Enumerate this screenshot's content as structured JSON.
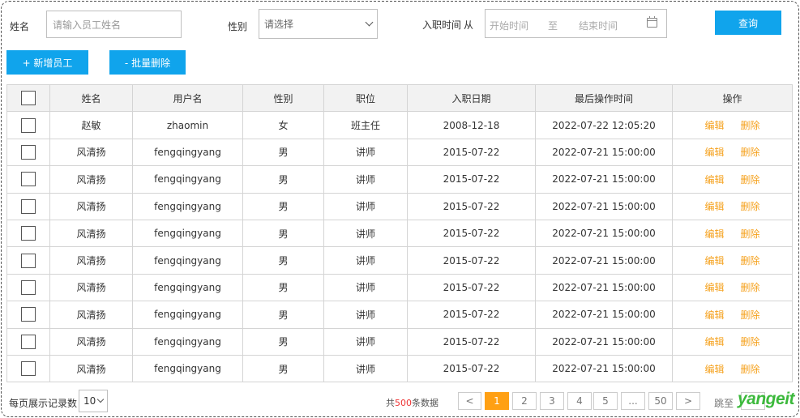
{
  "filters": {
    "name_label": "姓名",
    "name_placeholder": "请输入员工姓名",
    "gender_label": "性别",
    "gender_placeholder": "请选择",
    "date_label": "入职时间",
    "date_from": "从",
    "date_start_placeholder": "开始时间",
    "date_to": "至",
    "date_end_placeholder": "结束时间",
    "query_button": "查询"
  },
  "toolbar": {
    "add_button": "+ 新增员工",
    "batch_delete_button": "- 批量删除"
  },
  "table": {
    "headers": [
      "姓名",
      "用户名",
      "性别",
      "职位",
      "入职日期",
      "最后操作时间",
      "操作"
    ],
    "edit_label": "编辑",
    "delete_label": "删除",
    "rows": [
      {
        "name": "赵敏",
        "username": "zhaomin",
        "gender": "女",
        "position": "班主任",
        "entry_date": "2008-12-18",
        "last_op": "2022-07-22 12:05:20"
      },
      {
        "name": "风清扬",
        "username": "fengqingyang",
        "gender": "男",
        "position": "讲师",
        "entry_date": "2015-07-22",
        "last_op": "2022-07-21 15:00:00"
      },
      {
        "name": "风清扬",
        "username": "fengqingyang",
        "gender": "男",
        "position": "讲师",
        "entry_date": "2015-07-22",
        "last_op": "2022-07-21 15:00:00"
      },
      {
        "name": "风清扬",
        "username": "fengqingyang",
        "gender": "男",
        "position": "讲师",
        "entry_date": "2015-07-22",
        "last_op": "2022-07-21 15:00:00"
      },
      {
        "name": "风清扬",
        "username": "fengqingyang",
        "gender": "男",
        "position": "讲师",
        "entry_date": "2015-07-22",
        "last_op": "2022-07-21 15:00:00"
      },
      {
        "name": "风清扬",
        "username": "fengqingyang",
        "gender": "男",
        "position": "讲师",
        "entry_date": "2015-07-22",
        "last_op": "2022-07-21 15:00:00"
      },
      {
        "name": "风清扬",
        "username": "fengqingyang",
        "gender": "男",
        "position": "讲师",
        "entry_date": "2015-07-22",
        "last_op": "2022-07-21 15:00:00"
      },
      {
        "name": "风清扬",
        "username": "fengqingyang",
        "gender": "男",
        "position": "讲师",
        "entry_date": "2015-07-22",
        "last_op": "2022-07-21 15:00:00"
      },
      {
        "name": "风清扬",
        "username": "fengqingyang",
        "gender": "男",
        "position": "讲师",
        "entry_date": "2015-07-22",
        "last_op": "2022-07-21 15:00:00"
      },
      {
        "name": "风清扬",
        "username": "fengqingyang",
        "gender": "男",
        "position": "讲师",
        "entry_date": "2015-07-22",
        "last_op": "2022-07-21 15:00:00"
      }
    ]
  },
  "pagination": {
    "page_size_label": "每页展示记录数",
    "page_size_value": "10",
    "total_prefix": "共",
    "total_count": "500",
    "total_suffix": "条数据",
    "prev": "<",
    "pages": [
      "1",
      "2",
      "3",
      "4",
      "5",
      "...",
      "50"
    ],
    "next": ">",
    "jump_label": "跳至"
  },
  "brand": {
    "logo_text": "yangeit"
  },
  "colors": {
    "primary": "#10a4ec",
    "accent_orange": "#ffa014",
    "action_orange": "#f5a11d",
    "logo_green": "#3cb93c"
  }
}
